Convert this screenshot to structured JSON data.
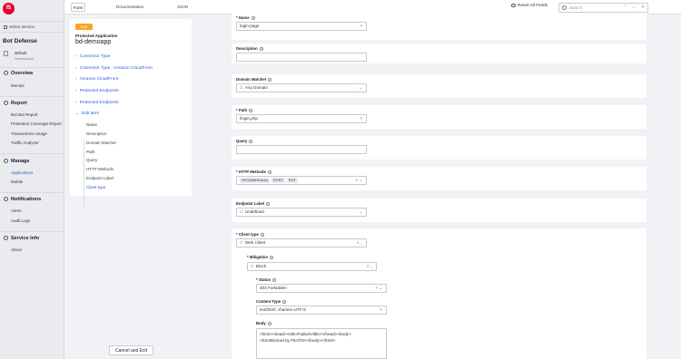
{
  "sidebar": {
    "logo": "f5",
    "select_service": "Select service",
    "app_title": "Bot Defense",
    "namespace": {
      "name": "default",
      "label": "Namespace"
    },
    "sections": [
      {
        "title": "Overview",
        "items": [
          "Monitor"
        ]
      },
      {
        "title": "Report",
        "items": [
          "Bot Bot Report",
          "Protection Coverage Report",
          "Transactions Usage",
          "Traffic Analyzer"
        ]
      },
      {
        "title": "Manage",
        "items": [
          "Applications",
          "Mobile"
        ]
      },
      {
        "title": "Notifications",
        "items": [
          "Alerts",
          "Audit Logs"
        ]
      },
      {
        "title": "Service Info",
        "items": [
          "About"
        ]
      }
    ]
  },
  "topbar": {
    "tabs": [
      "Form",
      "Documentation",
      "JSON"
    ],
    "reset_label": "Reset All Fields",
    "search_placeholder": "Search"
  },
  "left_panel": {
    "badge": "Edit",
    "label": "Protected Application",
    "name": "bd-demoapp",
    "tree": [
      "Connector Type",
      "Connector Type : Amazon CloudFront",
      "Amazon CloudFront",
      "Protected Endpoints",
      "Protected Endpoints",
      "Edit Item"
    ],
    "sub_items": [
      "Name",
      "Description",
      "Domain Matcher",
      "Path",
      "Query",
      "HTTP Methods",
      "Endpoint Label",
      "Client type"
    ],
    "cancel_label": "Cancel and Exit"
  },
  "form": {
    "name": {
      "label": "Name",
      "value": "login-page"
    },
    "description": {
      "label": "Description",
      "value": ""
    },
    "domain_matcher": {
      "label": "Domain Matcher",
      "value": "Any Domain"
    },
    "path": {
      "label": "Path",
      "value": "/login.php"
    },
    "query": {
      "label": "Query",
      "value": ""
    },
    "http_methods": {
      "label": "HTTP Methods",
      "chips": [
        "GET(WithFetch)",
        "POST",
        "PUT"
      ]
    },
    "endpoint_label": {
      "label": "Endpoint Label",
      "value": "Undefined"
    },
    "client_type": {
      "label": "Client type",
      "value": "Web Client"
    },
    "mitigation": {
      "label": "Mitigation",
      "value": "Block"
    },
    "status": {
      "label": "Status",
      "value": "403 Forbidden"
    },
    "content_type": {
      "label": "Content Type",
      "value": "text/html; charset=UTF-8"
    },
    "body": {
      "label": "Body",
      "line1": "<html><head><title>Failed</title></head><body>",
      "line2": "<h3>Blocked by F5</h3></body></html>"
    }
  }
}
